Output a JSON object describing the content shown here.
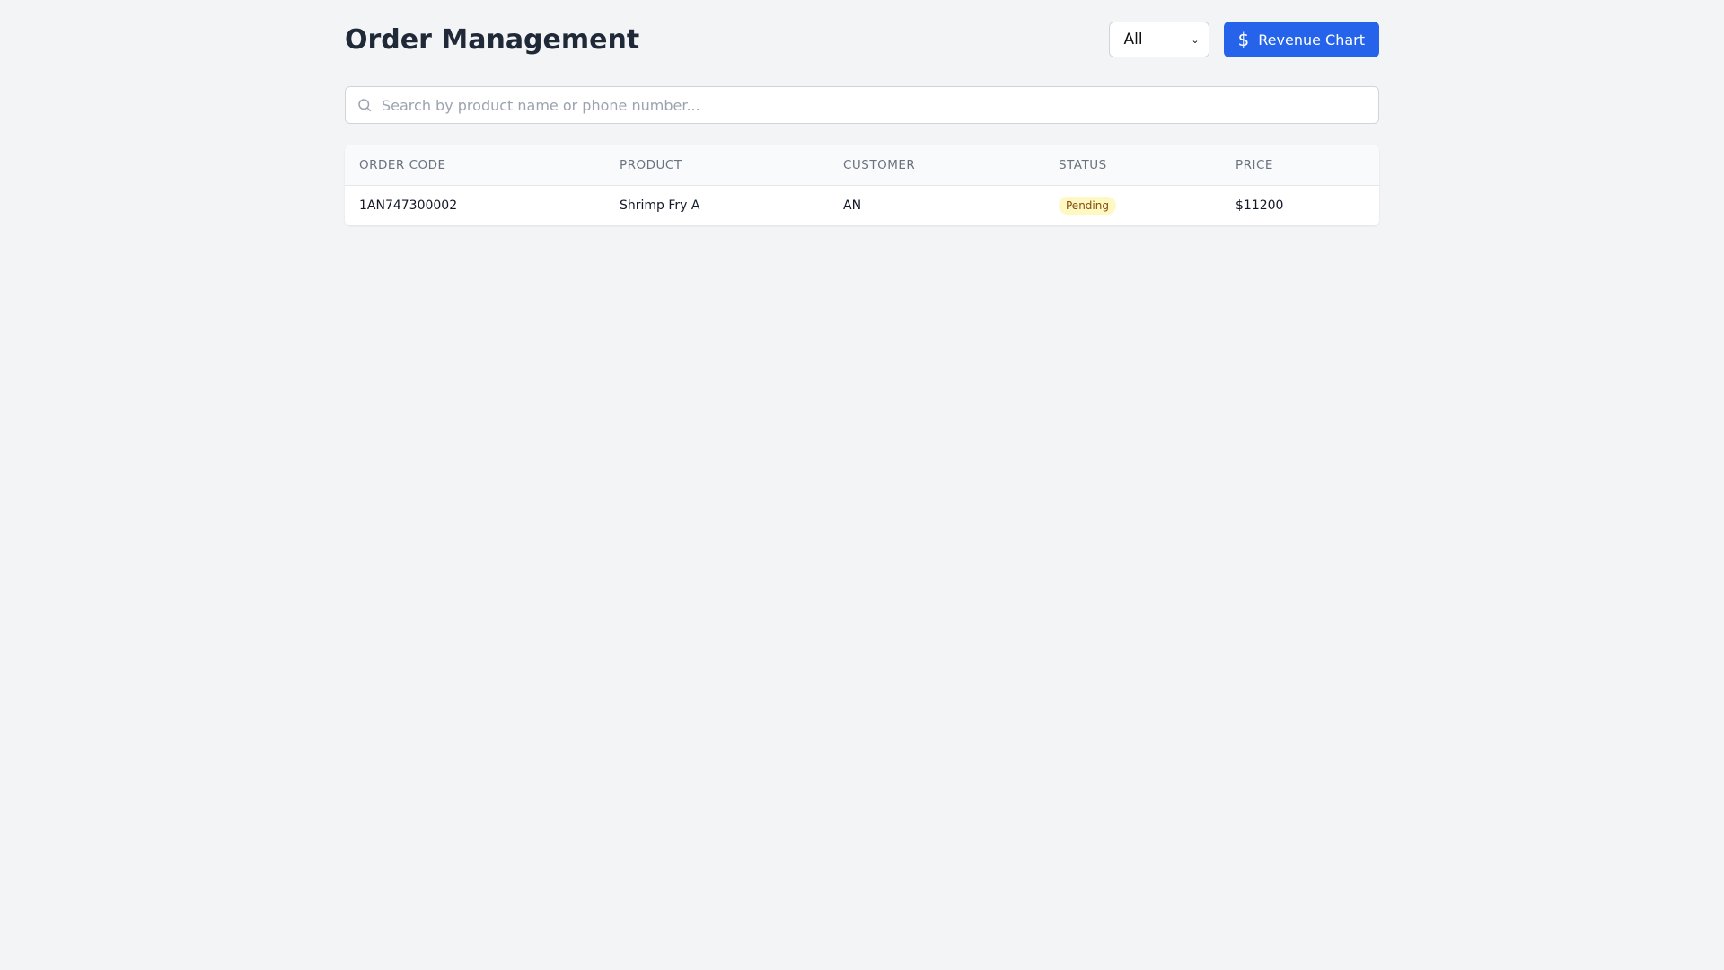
{
  "header": {
    "title": "Order Management",
    "filter_value": "All",
    "revenue_button": "Revenue Chart"
  },
  "search": {
    "placeholder": "Search by product name or phone number..."
  },
  "table": {
    "columns": [
      "ORDER CODE",
      "PRODUCT",
      "CUSTOMER",
      "STATUS",
      "PRICE"
    ],
    "rows": [
      {
        "order_code": "1AN747300002",
        "product": "Shrimp Fry A",
        "customer": "AN",
        "status": "Pending",
        "price": "$11200"
      }
    ]
  }
}
